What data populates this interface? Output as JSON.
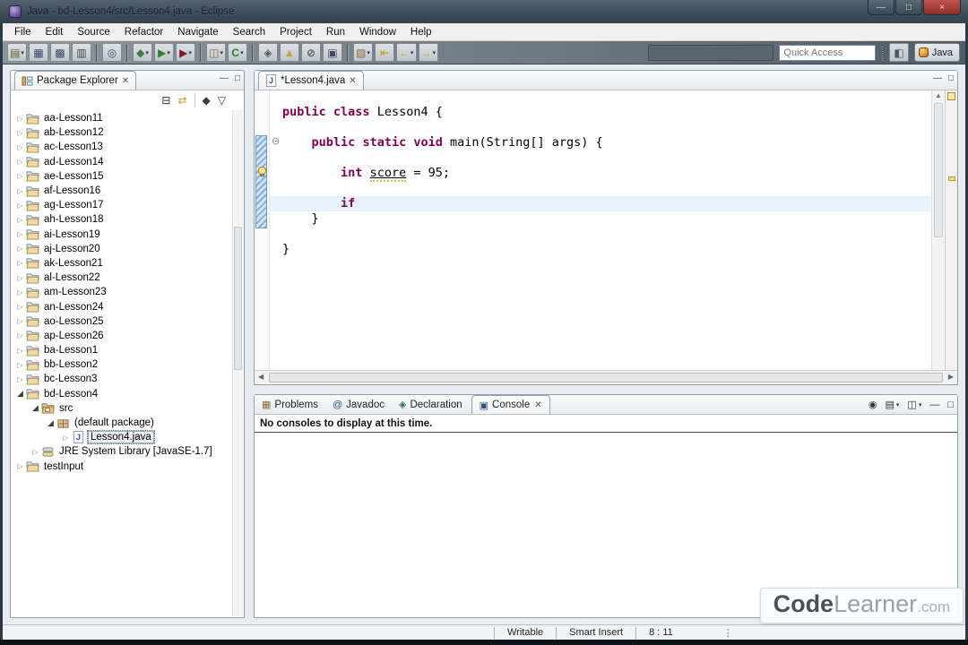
{
  "window": {
    "title": "Java - bd-Lesson4/src/Lesson4.java - Eclipse"
  },
  "titlebar_buttons": {
    "minimize": "—",
    "maximize": "□",
    "close": "×"
  },
  "menu": {
    "items": [
      "File",
      "Edit",
      "Source",
      "Refactor",
      "Navigate",
      "Search",
      "Project",
      "Run",
      "Window",
      "Help"
    ]
  },
  "toolbar": {
    "buttons": [
      {
        "name": "new-wizard",
        "glyph": "▤",
        "color": "#6b5a2a",
        "dd": true
      },
      {
        "name": "save",
        "glyph": "▦",
        "color": "#3a4d66",
        "dd": false
      },
      {
        "name": "save-all",
        "glyph": "▩",
        "color": "#3a4d66",
        "dd": false
      },
      {
        "name": "print",
        "glyph": "▥",
        "color": "#444",
        "dd": false
      },
      {
        "sep": true
      },
      {
        "name": "search",
        "glyph": "◎",
        "color": "#35506e",
        "dd": false
      },
      {
        "sep": true
      },
      {
        "name": "debug",
        "glyph": "◆",
        "color": "#3f7a3f",
        "dd": true
      },
      {
        "name": "run",
        "glyph": "▶",
        "color": "#2e7d32",
        "dd": true
      },
      {
        "name": "coverage",
        "glyph": "▶",
        "color": "#7a1f1f",
        "dd": true
      },
      {
        "sep": true
      },
      {
        "name": "new-java-project",
        "glyph": "◫",
        "color": "#8a6d3b",
        "dd": true
      },
      {
        "name": "new-java-class",
        "glyph": "C",
        "color": "#2e7d32",
        "dd": true
      },
      {
        "sep": true
      },
      {
        "name": "open-type",
        "glyph": "◈",
        "color": "#555",
        "dd": false
      },
      {
        "name": "mark-occurrences",
        "glyph": "▲",
        "color": "#c9a227",
        "dd": false
      },
      {
        "name": "skip-breakpoints",
        "glyph": "⊘",
        "color": "#555",
        "dd": false
      },
      {
        "name": "open-task",
        "glyph": "▣",
        "color": "#446",
        "dd": false
      },
      {
        "sep": true
      },
      {
        "name": "annotate",
        "glyph": "▧",
        "color": "#8a6d3b",
        "dd": true
      },
      {
        "name": "last-edit-location",
        "glyph": "⇤",
        "color": "#c9a227",
        "dd": false
      },
      {
        "name": "back",
        "glyph": "←",
        "color": "#c9a227",
        "dd": true
      },
      {
        "name": "forward",
        "glyph": "→",
        "color": "#c9a227",
        "dd": true
      }
    ],
    "quick_access_placeholder": "Quick Access",
    "perspective_label": "Java"
  },
  "explorer": {
    "title": "Package Explorer",
    "toolbar_icons": [
      {
        "name": "collapse-all",
        "glyph": "⊟",
        "color": "#333"
      },
      {
        "name": "link-with-editor",
        "glyph": "⇄",
        "color": "#c79b2e"
      },
      {
        "name": "focus",
        "glyph": "◆",
        "color": "#3a3a3a"
      },
      {
        "name": "view-menu",
        "glyph": "▽",
        "color": "#444"
      }
    ],
    "tree": [
      {
        "label": "aa-Lesson11",
        "depth": 0,
        "icon": "project",
        "state": "collapsed"
      },
      {
        "label": "ab-Lesson12",
        "depth": 0,
        "icon": "project",
        "state": "collapsed"
      },
      {
        "label": "ac-Lesson13",
        "depth": 0,
        "icon": "project",
        "state": "collapsed"
      },
      {
        "label": "ad-Lesson14",
        "depth": 0,
        "icon": "project",
        "state": "collapsed"
      },
      {
        "label": "ae-Lesson15",
        "depth": 0,
        "icon": "project",
        "state": "collapsed"
      },
      {
        "label": "af-Lesson16",
        "depth": 0,
        "icon": "project",
        "state": "collapsed"
      },
      {
        "label": "ag-Lesson17",
        "depth": 0,
        "icon": "project",
        "state": "collapsed"
      },
      {
        "label": "ah-Lesson18",
        "depth": 0,
        "icon": "project",
        "state": "collapsed"
      },
      {
        "label": "ai-Lesson19",
        "depth": 0,
        "icon": "project",
        "state": "collapsed"
      },
      {
        "label": "aj-Lesson20",
        "depth": 0,
        "icon": "project",
        "state": "collapsed"
      },
      {
        "label": "ak-Lesson21",
        "depth": 0,
        "icon": "project",
        "state": "collapsed"
      },
      {
        "label": "al-Lesson22",
        "depth": 0,
        "icon": "project",
        "state": "collapsed"
      },
      {
        "label": "am-Lesson23",
        "depth": 0,
        "icon": "project",
        "state": "collapsed"
      },
      {
        "label": "an-Lesson24",
        "depth": 0,
        "icon": "project",
        "state": "collapsed"
      },
      {
        "label": "ao-Lesson25",
        "depth": 0,
        "icon": "project",
        "state": "collapsed"
      },
      {
        "label": "ap-Lesson26",
        "depth": 0,
        "icon": "project",
        "state": "collapsed"
      },
      {
        "label": "ba-Lesson1",
        "depth": 0,
        "icon": "project",
        "state": "collapsed"
      },
      {
        "label": "bb-Lesson2",
        "depth": 0,
        "icon": "project",
        "state": "collapsed"
      },
      {
        "label": "bc-Lesson3",
        "depth": 0,
        "icon": "project",
        "state": "collapsed"
      },
      {
        "label": "bd-Lesson4",
        "depth": 0,
        "icon": "project",
        "state": "expanded"
      },
      {
        "label": "src",
        "depth": 1,
        "icon": "src",
        "state": "expanded"
      },
      {
        "label": "(default package)",
        "depth": 2,
        "icon": "package",
        "state": "expanded"
      },
      {
        "label": "Lesson4.java",
        "depth": 3,
        "icon": "jfile",
        "state": "collapsed",
        "selected": true
      },
      {
        "label": "JRE System Library [JavaSE-1.7]",
        "depth": 1,
        "icon": "library",
        "state": "collapsed"
      },
      {
        "label": "testInput",
        "depth": 0,
        "icon": "project",
        "state": "collapsed"
      }
    ]
  },
  "editor": {
    "tab_label": "*Lesson4.java",
    "code_lines": [
      {
        "seg": [
          [
            "public",
            "kw"
          ],
          [
            " ",
            "pl"
          ],
          [
            "class",
            "kw"
          ],
          [
            " Lesson4 {",
            "pl"
          ]
        ]
      },
      {
        "seg": []
      },
      {
        "fold": true,
        "seg": [
          [
            "    ",
            "pl"
          ],
          [
            "public",
            "kw"
          ],
          [
            " ",
            "pl"
          ],
          [
            "static",
            "kw"
          ],
          [
            " ",
            "pl"
          ],
          [
            "void",
            "kw"
          ],
          [
            " main(String[] args) {",
            "pl"
          ]
        ]
      },
      {
        "seg": []
      },
      {
        "bulb": true,
        "seg": [
          [
            "        ",
            "pl"
          ],
          [
            "int",
            "kw"
          ],
          [
            " ",
            "pl"
          ],
          [
            "score",
            "wn"
          ],
          [
            " = 95;",
            "pl"
          ]
        ]
      },
      {
        "seg": []
      },
      {
        "cur": true,
        "seg": [
          [
            "        ",
            "pl"
          ],
          [
            "if",
            "kw"
          ]
        ]
      },
      {
        "seg": [
          [
            "    }",
            "pl"
          ]
        ]
      },
      {
        "seg": []
      },
      {
        "seg": [
          [
            "}",
            "pl"
          ]
        ]
      }
    ]
  },
  "console": {
    "tabs": [
      {
        "label": "Problems",
        "icon": "problems",
        "glyph": "▦",
        "color": "#8a6d3b",
        "active": false
      },
      {
        "label": "Javadoc",
        "icon": "javadoc",
        "glyph": "@",
        "color": "#33507a",
        "active": false
      },
      {
        "label": "Declaration",
        "icon": "declaration",
        "glyph": "◈",
        "color": "#2e6d4f",
        "active": false
      },
      {
        "label": "Console",
        "icon": "console",
        "glyph": "▣",
        "color": "#33507a",
        "active": true,
        "closable": true
      }
    ],
    "toolbar_icons": [
      {
        "name": "pin-console",
        "glyph": "◉",
        "dd": false
      },
      {
        "name": "display-selected-console",
        "glyph": "▤",
        "dd": true
      },
      {
        "name": "open-console",
        "glyph": "◫",
        "dd": true
      },
      {
        "name": "minimize-view",
        "glyph": "—",
        "dd": false
      },
      {
        "name": "maximize-view",
        "glyph": "□",
        "dd": false
      }
    ],
    "message": "No consoles to display at this time."
  },
  "statusbar": {
    "fields": [
      "Writable",
      "Smart Insert",
      "8 : 11"
    ]
  },
  "watermark": {
    "bold": "Code",
    "light": "Learner",
    "suffix": ".com"
  },
  "colors": {
    "keyword": "#7f0055",
    "current_line": "#e8f2fc",
    "range_indicator": "#85aed6",
    "titlebar": "#3c4b57"
  }
}
